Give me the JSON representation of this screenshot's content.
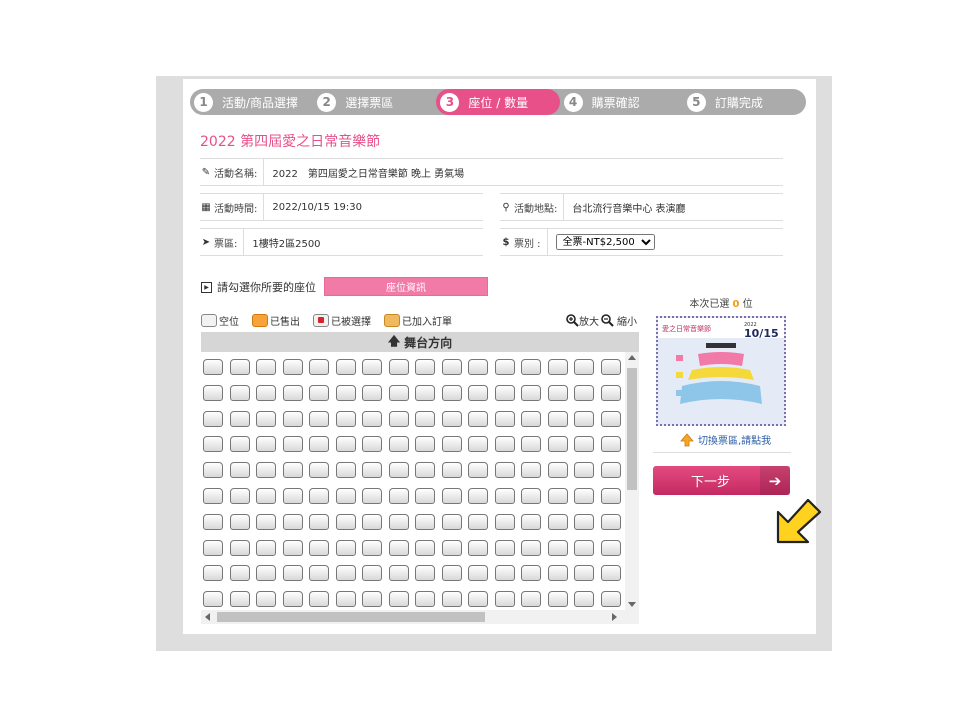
{
  "stepper": [
    {
      "num": "1",
      "label": "活動/商品選擇"
    },
    {
      "num": "2",
      "label": "選擇票區"
    },
    {
      "num": "3",
      "label": "座位 / 數量"
    },
    {
      "num": "4",
      "label": "購票確認"
    },
    {
      "num": "5",
      "label": "訂購完成"
    }
  ],
  "event_title": "2022 第四屆愛之日常音樂節",
  "info": {
    "name_label": "活動名稱:",
    "name_value": "2022　第四屆愛之日常音樂節 晚上 勇氣場",
    "time_label": "活動時間:",
    "time_value": "2022/10/15 19:30",
    "venue_label": "活動地點:",
    "venue_value": "台北流行音樂中心 表演廳",
    "area_label": "票區:",
    "area_value": "1樓特2區2500",
    "type_label": "票別 :",
    "type_value": "全票-NT$2,500"
  },
  "seat_pick_label": "請勾選你所要的座位",
  "seat_info_button": "座位資訊",
  "legend": {
    "empty": "空位",
    "sold": "已售出",
    "taken": "已被選擇",
    "added": "已加入訂單"
  },
  "zoom": {
    "in": "放大",
    "out": "縮小"
  },
  "stage_label": "舞台方向",
  "selected": {
    "prefix": "本次已選",
    "count": "0",
    "suffix": "位"
  },
  "map_thumb": {
    "brand": "愛之日常音樂節",
    "date": "10/15",
    "year": "2022"
  },
  "switch_area_link": "切換票區,請點我",
  "next_button": "下一步",
  "seatmap": {
    "rows": 10,
    "cols": 16
  },
  "colors": {
    "accent": "#e8508a",
    "stepper_bg": "#ababab",
    "link": "#2c5fa8",
    "count": "#f39c12"
  }
}
